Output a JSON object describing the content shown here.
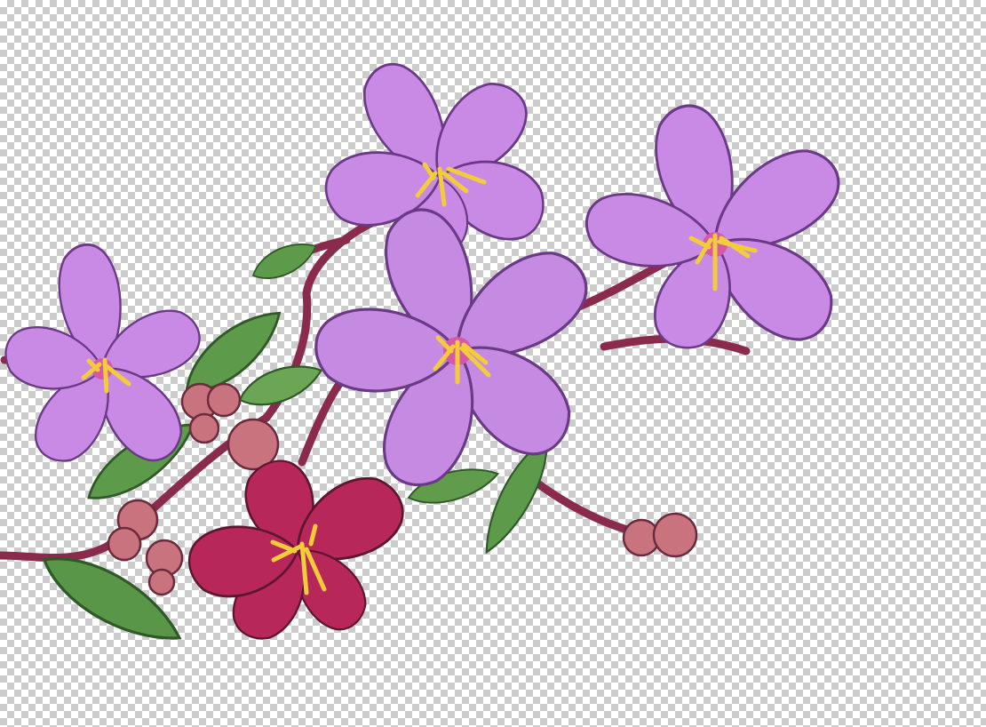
{
  "canvas": {
    "background": "transparent-checkerboard",
    "checker_colors": [
      "#ffffff",
      "#cccccc"
    ]
  },
  "artwork": {
    "subject": "flowering-branch-illustration",
    "colors": {
      "petal_lilac": "#c98ae6",
      "petal_lilac_dark": "#a964cc",
      "petal_crimson": "#b8275a",
      "stamen_yellow": "#f2cc3a",
      "leaf_green": "#5d9a4a",
      "leaf_dark": "#3e6e33",
      "stem_maroon": "#8a2a4c",
      "bud_pink": "#c9737e"
    }
  }
}
